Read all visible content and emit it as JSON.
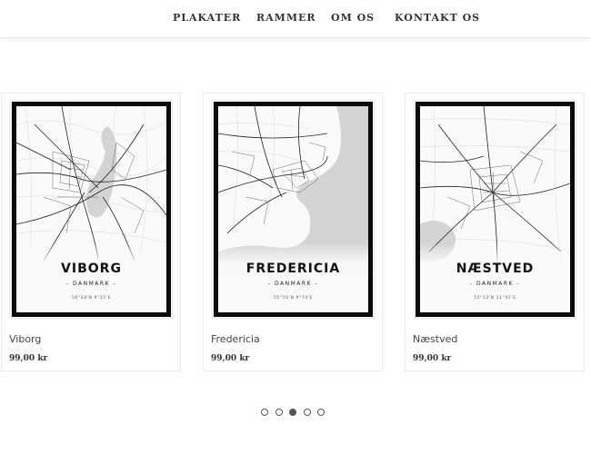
{
  "nav": {
    "items": [
      {
        "label": "PLAKATER"
      },
      {
        "label": "RAMMER"
      },
      {
        "label": "OM OS"
      },
      {
        "label": "KONTAKT OS"
      }
    ]
  },
  "products": [
    {
      "name": "Viborg",
      "price": "99,00 kr",
      "poster_city": "VIBORG",
      "poster_country": "- DANMARK -",
      "poster_coords": "56°28'N 9°25'E"
    },
    {
      "name": "Fredericia",
      "price": "99,00 kr",
      "poster_city": "FREDERICIA",
      "poster_country": "- DANMARK -",
      "poster_coords": "55°56'N 9°74'E"
    },
    {
      "name": "Næstved",
      "price": "99,00 kr",
      "poster_city": "NÆSTVED",
      "poster_country": "- DANMARK -",
      "poster_coords": "55°13'N 11°45'E"
    }
  ],
  "carousel": {
    "page_count": 5,
    "active_index": 2
  },
  "colors": {
    "frame": "#0b0b0b",
    "map_background": "#fafafa",
    "water": "#d4d4d4",
    "roads": "#222222"
  }
}
